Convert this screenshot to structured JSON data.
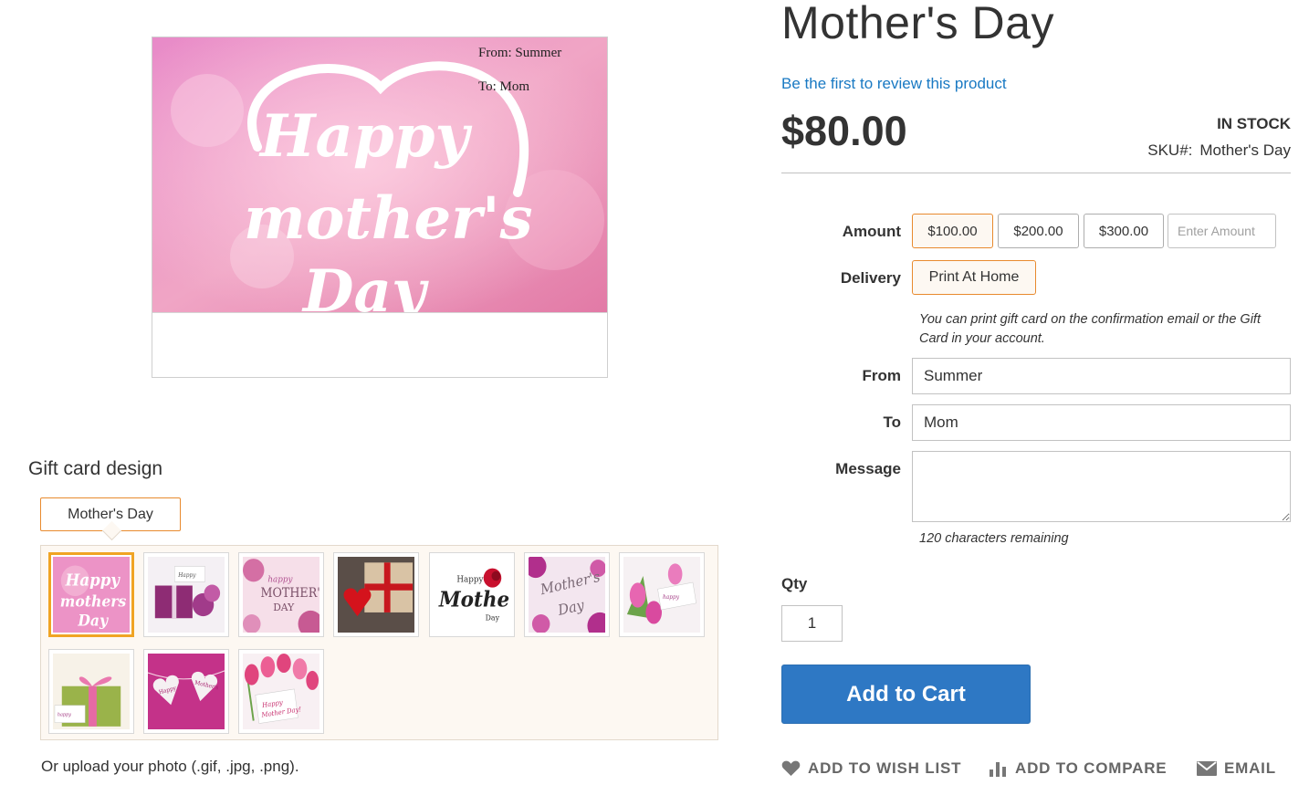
{
  "preview": {
    "from_line": "From: Summer",
    "to_line": "To: Mom"
  },
  "design": {
    "title": "Gift card design",
    "tab_label": "Mother's Day",
    "thumbnails": [
      {
        "name": "happy-mothers-day-pink",
        "selected": true
      },
      {
        "name": "purple-gift-box-roses",
        "selected": false
      },
      {
        "name": "happy-mothers-day-pastel",
        "selected": false
      },
      {
        "name": "red-heart-gift-box",
        "selected": false
      },
      {
        "name": "happy-mothers-day-rose",
        "selected": false
      },
      {
        "name": "mothers-day-orchids",
        "selected": false
      },
      {
        "name": "pink-tulips-card",
        "selected": false
      },
      {
        "name": "green-gift-polka-ribbon",
        "selected": false
      },
      {
        "name": "hearts-on-line",
        "selected": false
      },
      {
        "name": "tulips-happy-mothers-day",
        "selected": false
      }
    ],
    "upload_text": "Or upload your photo (.gif, .jpg, .png)."
  },
  "product": {
    "title": "Mother's Day",
    "review_link": "Be the first to review this product",
    "price": "$80.00",
    "stock": "IN STOCK",
    "sku_label": "SKU#:",
    "sku_value": "Mother's Day"
  },
  "form": {
    "amount_label": "Amount",
    "amounts": [
      "$100.00",
      "$200.00",
      "$300.00"
    ],
    "amount_placeholder": "Enter Amount",
    "delivery_label": "Delivery",
    "delivery_option": "Print At Home",
    "delivery_note": "You can print gift card on the confirmation email or the Gift Card in your account.",
    "from_label": "From",
    "from_value": "Summer",
    "to_label": "To",
    "to_value": "Mom",
    "message_label": "Message",
    "message_value": "",
    "chars_remaining": "120 characters remaining",
    "qty_label": "Qty",
    "qty_value": "1",
    "add_to_cart": "Add to Cart"
  },
  "actions": {
    "wishlist": "ADD TO WISH LIST",
    "compare": "ADD TO COMPARE",
    "email": "EMAIL"
  },
  "colors": {
    "accent_orange": "#e88a2e",
    "link_blue": "#1979c3",
    "button_blue": "#2e78c4",
    "panel_bg": "#fdf8f2"
  }
}
